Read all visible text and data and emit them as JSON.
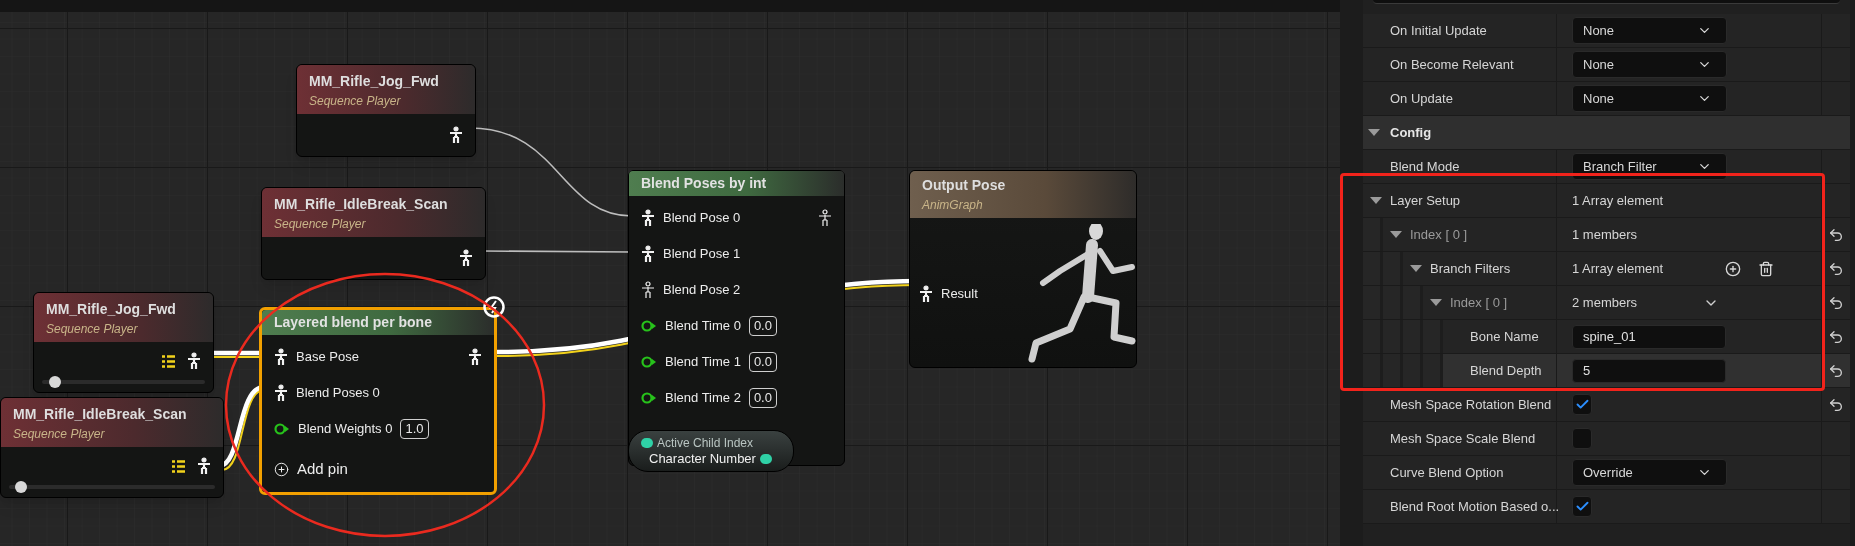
{
  "graph": {
    "nodes": [
      {
        "kind": "sequence_player",
        "title": "MM_Rifle_Jog_Fwd",
        "subtitle": "Sequence Player",
        "group_icon": false
      },
      {
        "kind": "sequence_player",
        "title": "MM_Rifle_IdleBreak_Scan",
        "subtitle": "Sequence Player",
        "group_icon": false
      },
      {
        "kind": "sequence_player",
        "title": "MM_Rifle_Jog_Fwd",
        "subtitle": "Sequence Player",
        "group_icon": true,
        "scrubber": {
          "level": 0.04
        }
      },
      {
        "kind": "sequence_player",
        "title": "MM_Rifle_IdleBreak_Scan",
        "subtitle": "Sequence Player",
        "group_icon": true,
        "scrubber": {
          "level": 0.03
        }
      },
      {
        "kind": "blend",
        "title": "Layered blend per bone",
        "selected": true,
        "output_connected": true,
        "pins": [
          {
            "kind": "pose",
            "label": "Base Pose",
            "connected": true
          },
          {
            "kind": "pose",
            "label": "Blend Poses 0",
            "connected": true
          },
          {
            "kind": "float",
            "label": "Blend Weights 0",
            "value": "1.0"
          }
        ],
        "add_pin": "Add pin"
      },
      {
        "kind": "blend",
        "title": "Blend Poses by int",
        "selected": false,
        "output_connected": false,
        "pins": [
          {
            "kind": "pose",
            "label": "Blend Pose 0",
            "connected": true
          },
          {
            "kind": "pose",
            "label": "Blend Pose 1",
            "connected": true
          },
          {
            "kind": "pose",
            "label": "Blend Pose 2",
            "connected": false
          },
          {
            "kind": "float",
            "label": "Blend Time 0",
            "value": "0.0"
          },
          {
            "kind": "float",
            "label": "Blend Time 1",
            "value": "0.0"
          },
          {
            "kind": "float",
            "label": "Blend Time 2",
            "value": "0.0"
          }
        ],
        "bottom_pin": "Active Child Index"
      },
      {
        "kind": "output",
        "title": "Output Pose",
        "subtitle": "AnimGraph",
        "pins": [
          {
            "kind": "pose",
            "label": "Result",
            "connected": true
          }
        ]
      }
    ],
    "variable": {
      "label": "Character Number"
    }
  },
  "details": {
    "rows": [
      {
        "kind": "dropdown",
        "label": "On Initial Update",
        "value": "None"
      },
      {
        "kind": "dropdown",
        "label": "On Become Relevant",
        "value": "None"
      },
      {
        "kind": "dropdown",
        "label": "On Update",
        "value": "None"
      },
      {
        "kind": "category",
        "label": "Config",
        "expanded": true
      },
      {
        "kind": "dropdown",
        "label": "Blend Mode",
        "value": "Branch Filter"
      },
      {
        "kind": "group",
        "label": "Layer Setup",
        "value": "1 Array element",
        "expanded": true,
        "children": [
          {
            "kind": "group",
            "label": "Index [ 0 ]",
            "value": "1 members",
            "expanded": true,
            "resettable": true,
            "children": [
              {
                "kind": "group",
                "label": "Branch Filters",
                "value": "1 Array element",
                "expanded": true,
                "resettable": true,
                "array_controls": true,
                "children": [
                  {
                    "kind": "group",
                    "label": "Index [ 0 ]",
                    "value": "2 members",
                    "expanded": true,
                    "resettable": true,
                    "options_menu": true,
                    "children": [
                      {
                        "kind": "text",
                        "label": "Bone Name",
                        "value": "spine_01",
                        "resettable": true,
                        "highlighted": false
                      },
                      {
                        "kind": "text",
                        "label": "Blend Depth",
                        "value": "5",
                        "resettable": true,
                        "highlighted": true
                      }
                    ]
                  }
                ]
              }
            ]
          }
        ]
      },
      {
        "kind": "checkbox",
        "label": "Mesh Space Rotation Blend",
        "checked": true,
        "resettable": true
      },
      {
        "kind": "checkbox",
        "label": "Mesh Space Scale Blend",
        "checked": false
      },
      {
        "kind": "dropdown",
        "label": "Curve Blend Option",
        "value": "Override"
      },
      {
        "kind": "checkbox",
        "label": "Blend Root Motion Based o...",
        "checked": true
      }
    ]
  }
}
